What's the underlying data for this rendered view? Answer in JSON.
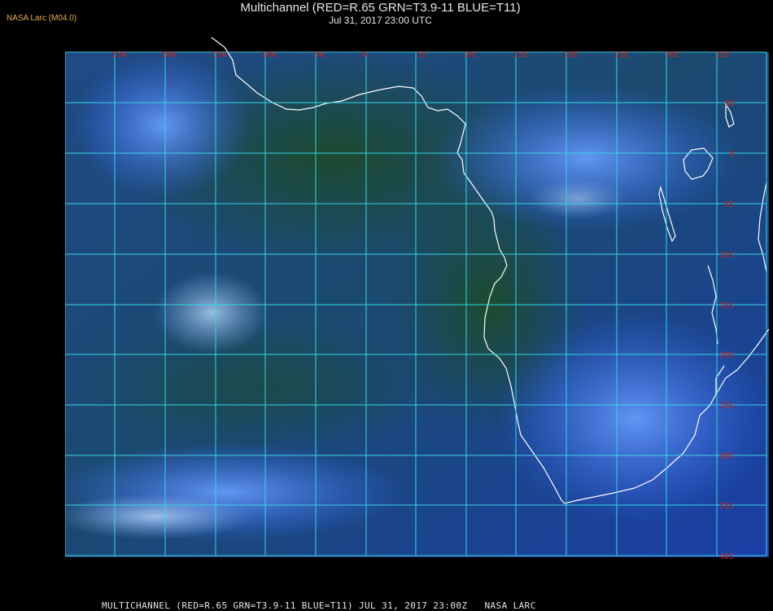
{
  "header": {
    "badge": "NASA Larc (M04.0)",
    "title": "Multichannel (RED=R.65 GRN=T3.9-11 BLUE=T11)",
    "subtitle": "Jul 31, 2017 23:00 UTC"
  },
  "map": {
    "lon_labels": [
      "25W",
      "20W",
      "15W",
      "10W",
      "5W",
      "0",
      "5E",
      "10E",
      "15E",
      "20E",
      "25E",
      "30E",
      "35E"
    ],
    "lat_labels": [
      "5N",
      "0",
      "5S",
      "10S",
      "15S",
      "20S",
      "25S",
      "30S",
      "35S",
      "40S"
    ],
    "grid_color": "#33d6e6",
    "label_color": "#c8241c",
    "coast_color": "#ffffff"
  },
  "footer": {
    "text": "MULTICHANNEL (RED=R.65 GRN=T3.9-11 BLUE=T11) JUL 31, 2017 23:00Z   NASA LARC"
  }
}
